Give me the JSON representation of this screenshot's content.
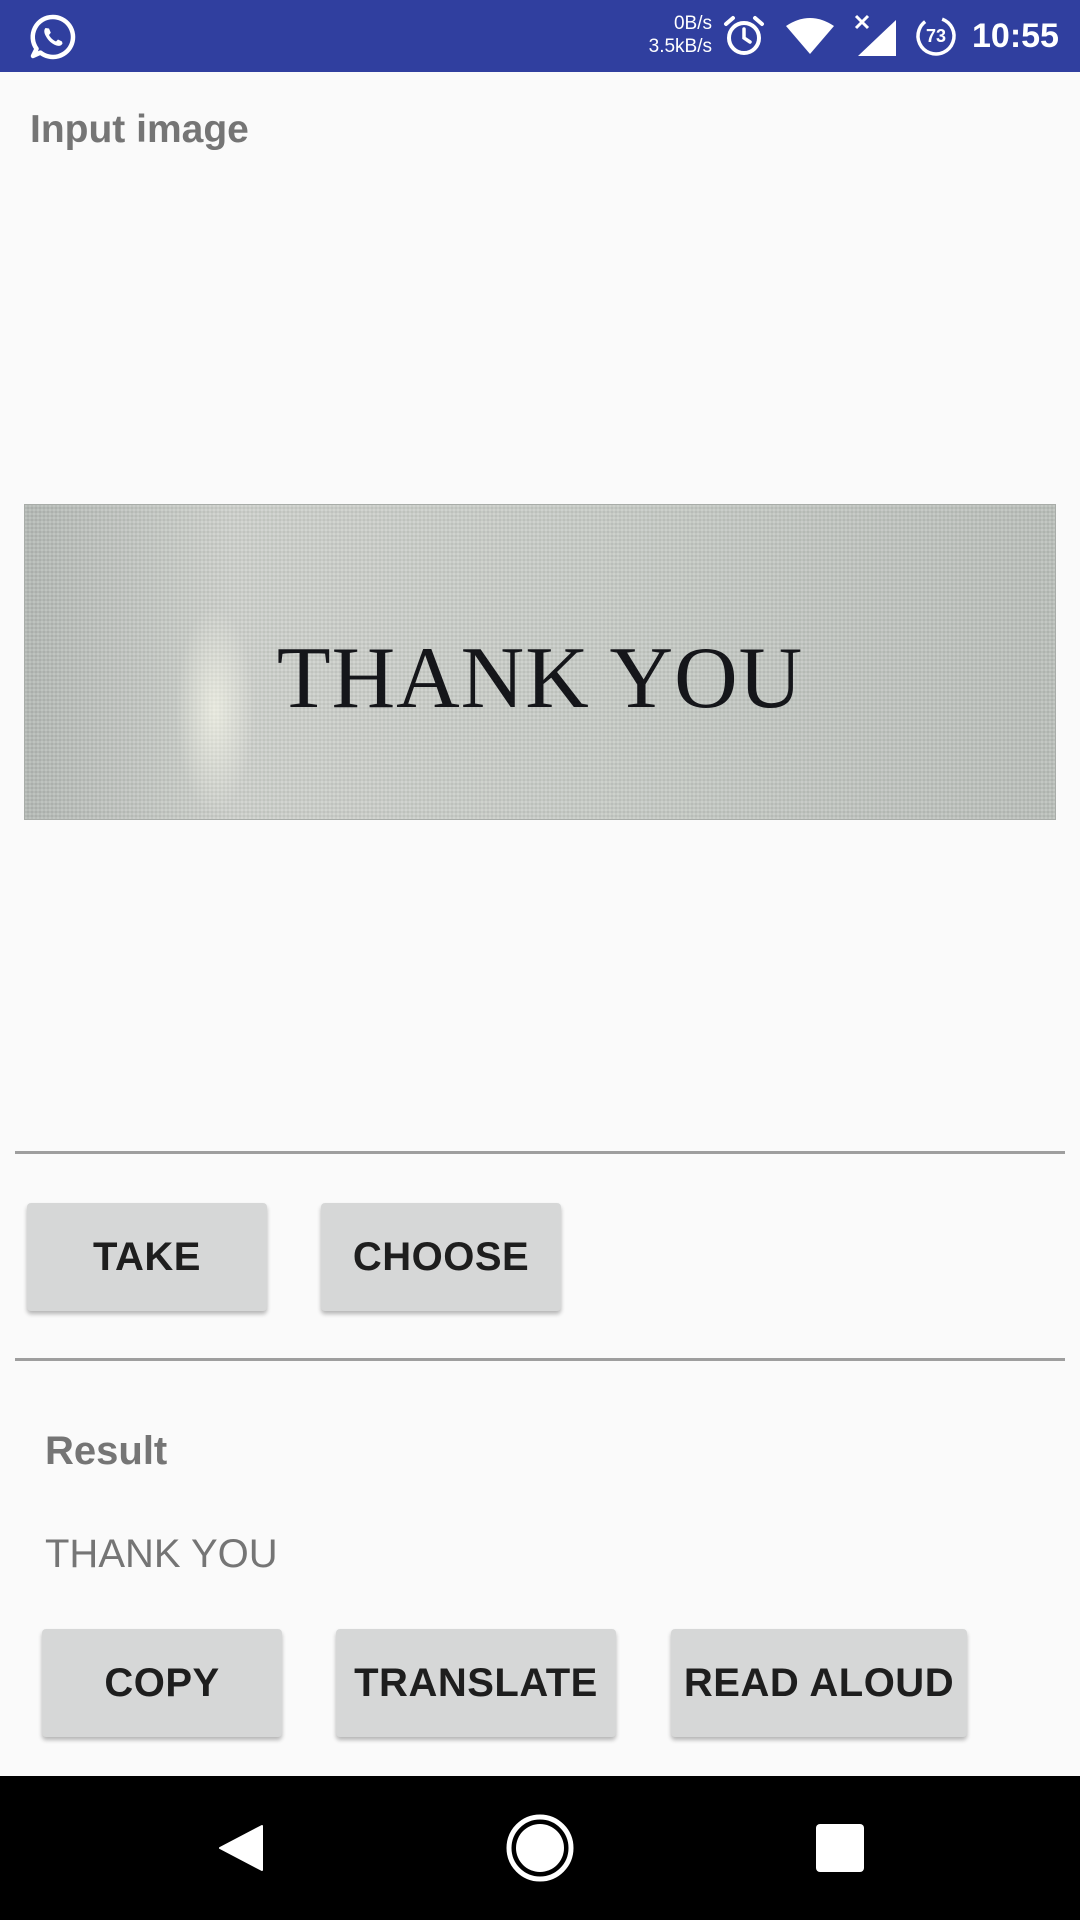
{
  "status_bar": {
    "background": "#303f9f",
    "left_icon": "whatsapp-icon",
    "net_up": "0B/s",
    "net_down": "3.5kB/s",
    "icons": [
      "alarm-icon",
      "wifi-icon",
      "cellular-no-data-icon",
      "battery-saver-icon"
    ],
    "battery_level": "73",
    "time": "10:55"
  },
  "input_section": {
    "label": "Input image",
    "image": {
      "description_icon": "photo-of-printed-text",
      "text_in_image": "THANK YOU"
    }
  },
  "image_buttons": {
    "take_label": "TAKE",
    "choose_label": "CHOOSE"
  },
  "result_section": {
    "label": "Result",
    "text": "THANK YOU"
  },
  "result_buttons": {
    "copy_label": "COPY",
    "translate_label": "TRANSLATE",
    "read_aloud_label": "READ ALOUD"
  },
  "nav_bar": {
    "background": "#000000",
    "buttons": [
      "back-icon",
      "home-icon",
      "recents-icon"
    ]
  },
  "colors": {
    "page_background": "#fafafa",
    "button_background": "#d6d7d7",
    "label_text": "#757575",
    "divider": "#9e9e9e"
  }
}
